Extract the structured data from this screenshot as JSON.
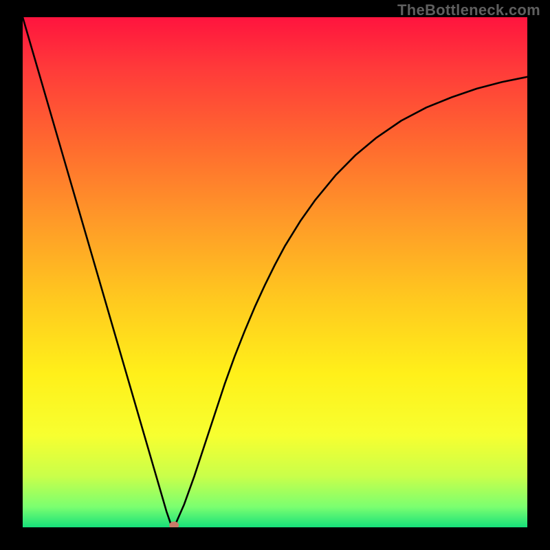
{
  "watermark": "TheBottleneck.com",
  "chart_data": {
    "type": "line",
    "title": "",
    "xlabel": "",
    "ylabel": "",
    "xlim": [
      0,
      100
    ],
    "ylim": [
      0,
      100
    ],
    "series": [
      {
        "name": "bottleneck-curve",
        "x": [
          0,
          2,
          4,
          6,
          8,
          10,
          12,
          14,
          16,
          18,
          20,
          22,
          24,
          26,
          27.5,
          28.5,
          29.3,
          30,
          32,
          34,
          36,
          38,
          40,
          42,
          44,
          46,
          48,
          50,
          52,
          55,
          58,
          62,
          66,
          70,
          75,
          80,
          85,
          90,
          95,
          100
        ],
        "y": [
          100,
          93.2,
          86.4,
          79.6,
          72.8,
          66.0,
          59.2,
          52.4,
          45.6,
          38.8,
          32.0,
          25.2,
          18.4,
          11.6,
          6.5,
          3.1,
          0.8,
          0.0,
          4.5,
          10.0,
          16.0,
          22.0,
          28.0,
          33.5,
          38.5,
          43.2,
          47.5,
          51.5,
          55.2,
          60.0,
          64.2,
          69.0,
          73.0,
          76.3,
          79.7,
          82.3,
          84.3,
          86.0,
          87.3,
          88.3
        ]
      }
    ],
    "marker": {
      "x": 30,
      "y": 0,
      "color": "#c97a68"
    },
    "gradient_stops": [
      {
        "offset": 0.0,
        "color": "#ff143e"
      },
      {
        "offset": 0.1,
        "color": "#ff3a3a"
      },
      {
        "offset": 0.25,
        "color": "#ff6a2f"
      },
      {
        "offset": 0.4,
        "color": "#ff9a28"
      },
      {
        "offset": 0.55,
        "color": "#ffc81f"
      },
      {
        "offset": 0.7,
        "color": "#fff01a"
      },
      {
        "offset": 0.82,
        "color": "#f7ff30"
      },
      {
        "offset": 0.9,
        "color": "#c9ff4a"
      },
      {
        "offset": 0.96,
        "color": "#7bff70"
      },
      {
        "offset": 1.0,
        "color": "#16e07a"
      }
    ]
  }
}
